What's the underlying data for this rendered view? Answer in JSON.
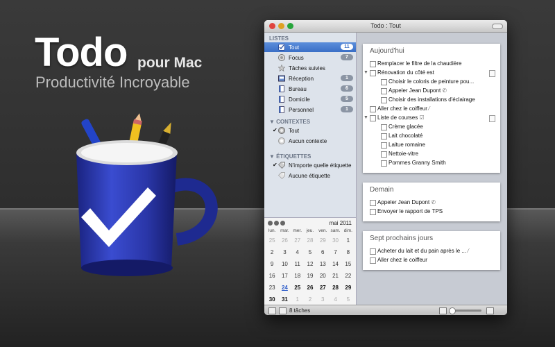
{
  "hero": {
    "title": "Todo",
    "subtitle": "pour Mac",
    "tagline": "Productivité Incroyable"
  },
  "window": {
    "title": "Todo : Tout"
  },
  "sidebar": {
    "lists_header": "LISTES",
    "lists": [
      {
        "label": "Tout",
        "count": "11",
        "icon": "checkbox-icon",
        "selected": true
      },
      {
        "label": "Focus",
        "count": "7",
        "icon": "target-icon"
      },
      {
        "label": "Tâches suivies",
        "count": "",
        "icon": "star-icon"
      },
      {
        "label": "Réception",
        "count": "1",
        "icon": "inbox-icon"
      },
      {
        "label": "Bureau",
        "count": "6",
        "icon": "document-icon"
      },
      {
        "label": "Domicile",
        "count": "5",
        "icon": "document-icon"
      },
      {
        "label": "Personnel",
        "count": "1",
        "icon": "document-icon"
      }
    ],
    "contexts_header": "CONTEXTES",
    "contexts": [
      {
        "label": "Tout",
        "checked": true,
        "icon": "context-icon"
      },
      {
        "label": "Aucun contexte",
        "checked": false,
        "icon": "context-icon"
      }
    ],
    "tags_header": "ÉTIQUETTES",
    "tags": [
      {
        "label": "N'importe quelle étiquette",
        "checked": true,
        "icon": "tag-icon"
      },
      {
        "label": "Aucune étiquette",
        "checked": false,
        "icon": "tag-icon"
      }
    ]
  },
  "calendar": {
    "month": "mai 2011",
    "weekdays": [
      "lun.",
      "mar.",
      "mer.",
      "jeu.",
      "ven.",
      "sam.",
      "dim."
    ],
    "weeks": [
      [
        "25",
        "26",
        "27",
        "28",
        "29",
        "30",
        "1"
      ],
      [
        "2",
        "3",
        "4",
        "5",
        "6",
        "7",
        "8"
      ],
      [
        "9",
        "10",
        "11",
        "12",
        "13",
        "14",
        "15"
      ],
      [
        "16",
        "17",
        "18",
        "19",
        "20",
        "21",
        "22"
      ],
      [
        "23",
        "24",
        "25",
        "26",
        "27",
        "28",
        "29"
      ],
      [
        "30",
        "31",
        "1",
        "2",
        "3",
        "4",
        "5"
      ]
    ],
    "today": "24"
  },
  "sections": [
    {
      "title": "Aujourd'hui",
      "tasks": [
        {
          "text": "Remplacer le filtre de la chaudière",
          "indent": 0
        },
        {
          "text": "Rénovation du côté est",
          "indent": 0,
          "expanded": true,
          "note": true
        },
        {
          "text": "Choisir le coloris de peinture pou...",
          "indent": 1
        },
        {
          "text": "Appeler Jean Dupont",
          "indent": 1,
          "glyph": "✆"
        },
        {
          "text": "Choisir des installations d'éclairage",
          "indent": 1
        },
        {
          "text": "Aller chez le coiffeur",
          "indent": 0,
          "glyph": "⁄"
        },
        {
          "text": "Liste de courses",
          "indent": 0,
          "expanded": true,
          "glyph": "☑",
          "note": true
        },
        {
          "text": "Crème glacée",
          "indent": 1
        },
        {
          "text": "Lait chocolaté",
          "indent": 1
        },
        {
          "text": "Laitue romaine",
          "indent": 1
        },
        {
          "text": "Nettoie-vitre",
          "indent": 1
        },
        {
          "text": "Pommes Granny Smith",
          "indent": 1
        }
      ]
    },
    {
      "title": "Demain",
      "tasks": [
        {
          "text": "Appeler Jean Dupont",
          "indent": 0,
          "glyph": "✆"
        },
        {
          "text": "Envoyer le rapport de TPS",
          "indent": 0
        }
      ]
    },
    {
      "title": "Sept prochains jours",
      "tasks": [
        {
          "text": "Acheter du lait et du pain après le ...",
          "indent": 0,
          "glyph": "⁄"
        },
        {
          "text": "Aller chez le coiffeur",
          "indent": 0
        }
      ]
    }
  ],
  "statusbar": {
    "count": "8 tâches"
  },
  "colors": {
    "accent": "#3a6fc6",
    "mug": "#2b3aa8"
  }
}
